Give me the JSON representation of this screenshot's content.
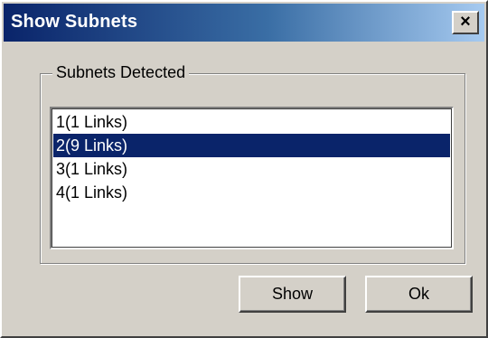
{
  "window": {
    "title": "Show Subnets",
    "close_label": "×"
  },
  "group": {
    "label": "Subnets Detected"
  },
  "subnets": {
    "items": [
      {
        "label": "1(1 Links)",
        "selected": false
      },
      {
        "label": "2(9 Links)",
        "selected": true
      },
      {
        "label": "3(1 Links)",
        "selected": false
      },
      {
        "label": "4(1 Links)",
        "selected": false
      }
    ]
  },
  "buttons": {
    "show_label": "Show",
    "ok_label": "Ok"
  },
  "colors": {
    "titlebar": "#0a246a",
    "selection": "#0a246a",
    "face": "#d4d0c8"
  }
}
